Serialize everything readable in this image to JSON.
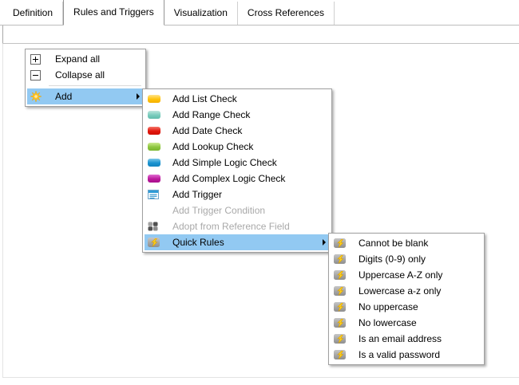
{
  "tabs": [
    {
      "label": "Definition",
      "selected": false
    },
    {
      "label": "Rules and Triggers",
      "selected": true
    },
    {
      "label": "Visualization",
      "selected": false
    },
    {
      "label": "Cross References",
      "selected": false
    }
  ],
  "context_menu": {
    "items": [
      {
        "label": "Expand all",
        "icon": "plus-box",
        "disabled": false
      },
      {
        "label": "Collapse all",
        "icon": "minus-box",
        "disabled": false
      },
      {
        "label": "Add",
        "icon": "sparkle",
        "disabled": false,
        "highlighted": true,
        "has_submenu": true
      }
    ]
  },
  "add_submenu": {
    "items": [
      {
        "label": "Add List Check",
        "icon": "pill",
        "icon_color": "#ffc30b",
        "disabled": false
      },
      {
        "label": "Add Range Check",
        "icon": "pill",
        "icon_color": "#79ccbd",
        "disabled": false
      },
      {
        "label": "Add Date Check",
        "icon": "pill",
        "icon_color": "#e3170d",
        "disabled": false
      },
      {
        "label": "Add Lookup Check",
        "icon": "pill",
        "icon_color": "#8cc63e",
        "disabled": false
      },
      {
        "label": "Add Simple Logic Check",
        "icon": "pill",
        "icon_color": "#1b93d0",
        "disabled": false
      },
      {
        "label": "Add Complex Logic Check",
        "icon": "pill",
        "icon_color": "#bb1a9c",
        "disabled": false
      },
      {
        "label": "Add Trigger",
        "icon": "trigger-list",
        "disabled": false
      },
      {
        "label": "Add Trigger Condition",
        "icon": "none",
        "disabled": true
      },
      {
        "label": "Adopt from Reference Field",
        "icon": "grid",
        "disabled": true
      },
      {
        "label": "Quick Rules",
        "icon": "lightning",
        "disabled": false,
        "highlighted": true,
        "has_submenu": true
      }
    ]
  },
  "quick_rules_submenu": {
    "items": [
      {
        "label": "Cannot be blank"
      },
      {
        "label": "Digits (0-9) only"
      },
      {
        "label": "Uppercase A-Z only"
      },
      {
        "label": "Lowercase a-z only"
      },
      {
        "label": "No uppercase"
      },
      {
        "label": "No lowercase"
      },
      {
        "label": "Is an email address"
      },
      {
        "label": "Is a valid password"
      }
    ]
  },
  "colors": {
    "menu_highlight": "#92c9f2",
    "menu_border": "#a0a0a0",
    "disabled_text": "#a9a9a9",
    "lightning_yellow": "#ffd21c",
    "sparkle_gold": "#ffc425"
  }
}
